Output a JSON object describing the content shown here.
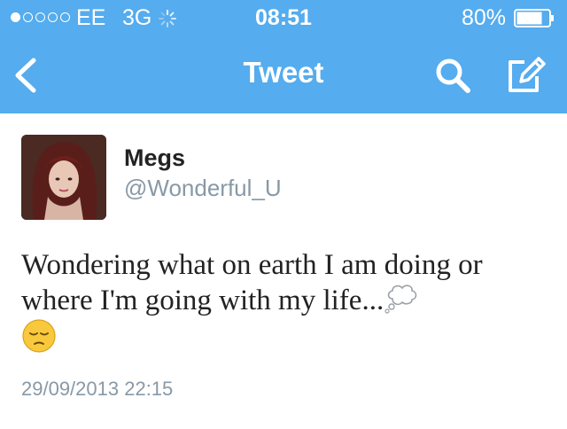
{
  "status_bar": {
    "signal_filled": 1,
    "signal_total": 5,
    "carrier": "EE",
    "network": "3G",
    "time": "08:51",
    "battery": "80%",
    "battery_level": 0.8,
    "icons": [
      "activity-spinner-icon",
      "battery-icon"
    ]
  },
  "nav": {
    "title": "Tweet",
    "icons": [
      "back-chevron-icon",
      "search-icon",
      "compose-icon"
    ]
  },
  "tweet": {
    "author_name": "Megs",
    "author_handle": "@Wonderful_U",
    "text": "Wondering what on earth I am doing or where I'm going with my life...",
    "emojis": [
      "thought-bubble-icon",
      "pensive-face-icon"
    ],
    "timestamp": "29/09/2013 22:15"
  },
  "colors": {
    "bar": "#55acee",
    "text": "#222222",
    "muted": "#8899a6"
  }
}
